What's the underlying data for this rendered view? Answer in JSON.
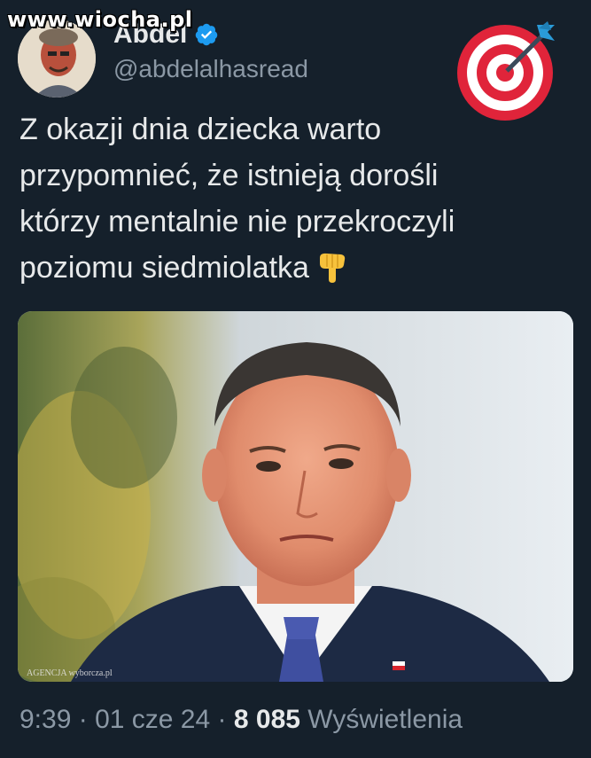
{
  "watermark": "www.wiocha.pl",
  "author": {
    "display_name": "Abdel",
    "handle": "@abdelalhasread",
    "verified": true,
    "avatar_icon": "avatar-photo"
  },
  "header_emoji": "direct-hit-target-icon",
  "tweet": {
    "lines": [
      "Z okazji dnia dziecka warto",
      "przypomnieć, że istnieją dorośli",
      "którzy mentalnie nie przekroczyli",
      "poziomu siedmiolatka"
    ],
    "trailing_emoji": "backhand-index-pointing-down-icon"
  },
  "media": {
    "credit": "AGENCJA wyborcza.pl"
  },
  "meta": {
    "time": "9:39",
    "separator": "·",
    "date": "01 cze 24",
    "views_count": "8 085",
    "views_label": "Wyświetlenia"
  },
  "colors": {
    "background": "#15202b",
    "primary_text": "#e7e9ea",
    "secondary_text": "#8b98a5",
    "verified": "#1d9bf0"
  }
}
